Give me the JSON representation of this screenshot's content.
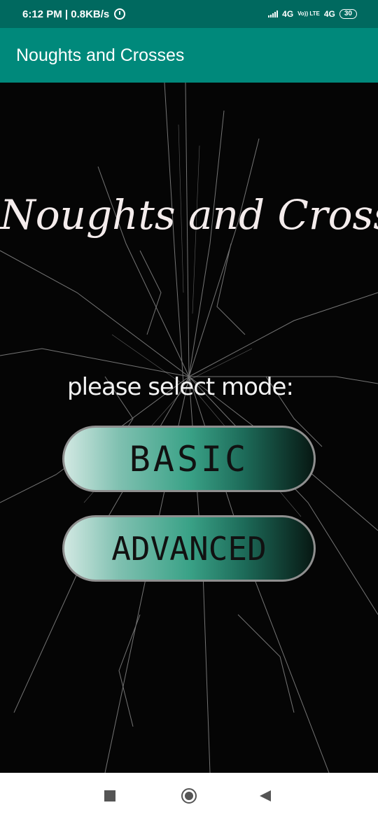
{
  "status_bar": {
    "time_speed": "6:12 PM | 0.8KB/s",
    "network_1": "4G",
    "volte": "Vo)) LTE",
    "network_2": "4G",
    "battery": "30"
  },
  "app_bar": {
    "title": "Noughts and Crosses"
  },
  "main": {
    "game_title": "Noughts and Crosses",
    "mode_prompt": "please select mode:",
    "basic_label": "BASIC",
    "advanced_label": "ADVANCED"
  },
  "icons": [
    "alarm-icon",
    "signal-icon",
    "battery-icon",
    "recents-icon",
    "home-icon",
    "back-icon"
  ]
}
